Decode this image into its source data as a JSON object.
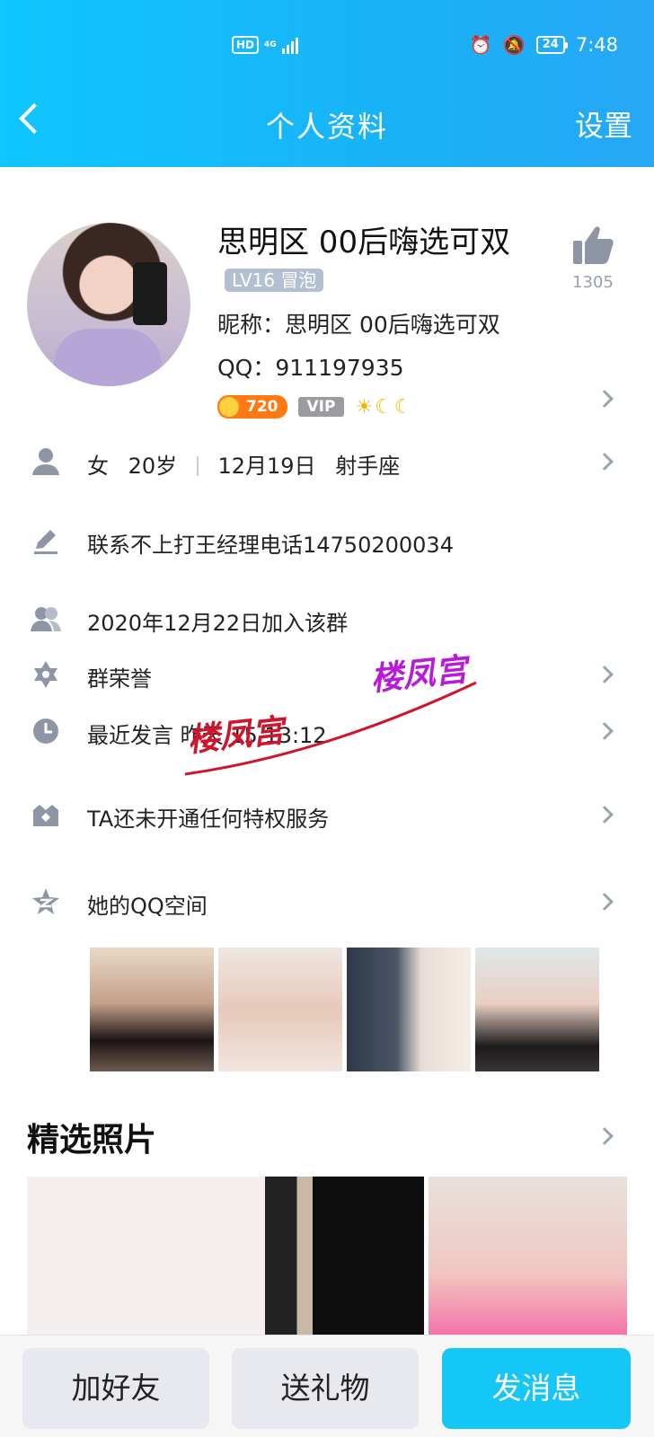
{
  "status_bar": {
    "hd": "HD",
    "network": "4G",
    "battery": "24",
    "time": "7:48"
  },
  "header": {
    "title": "个人资料",
    "settings": "设置"
  },
  "profile": {
    "name": "思明区  00后嗨选可双",
    "level_badge": "LV16 冒泡",
    "nickname": "昵称：思明区  00后嗨选可双",
    "qq": "QQ：911197935",
    "coin_value": "720",
    "vip": "VIP",
    "likes": "1305"
  },
  "info_rows": {
    "gender": "女",
    "age": "20岁",
    "birthday": "12月19日",
    "zodiac": "射手座",
    "signature": "联系不上打王经理电话14750200034",
    "joined": "2020年12月22日加入该群",
    "group_honor": "群荣誉",
    "last_post": "最近发言 昨天 15 13:12",
    "privilege": "TA还未开通任何特权服务",
    "qzone": "她的QQ空间"
  },
  "watermark": {
    "text1": "楼凤宫",
    "text2": "楼凤宫"
  },
  "featured": {
    "title": "精选照片"
  },
  "bottom_bar": {
    "add_friend": "加好友",
    "send_gift": "送礼物",
    "send_message": "发消息"
  },
  "colors": {
    "header_gradient_start": "#10c6ff",
    "header_gradient_end": "#27a7f5",
    "primary_button": "#14c7f6",
    "icon_gray": "#8e96a6"
  }
}
